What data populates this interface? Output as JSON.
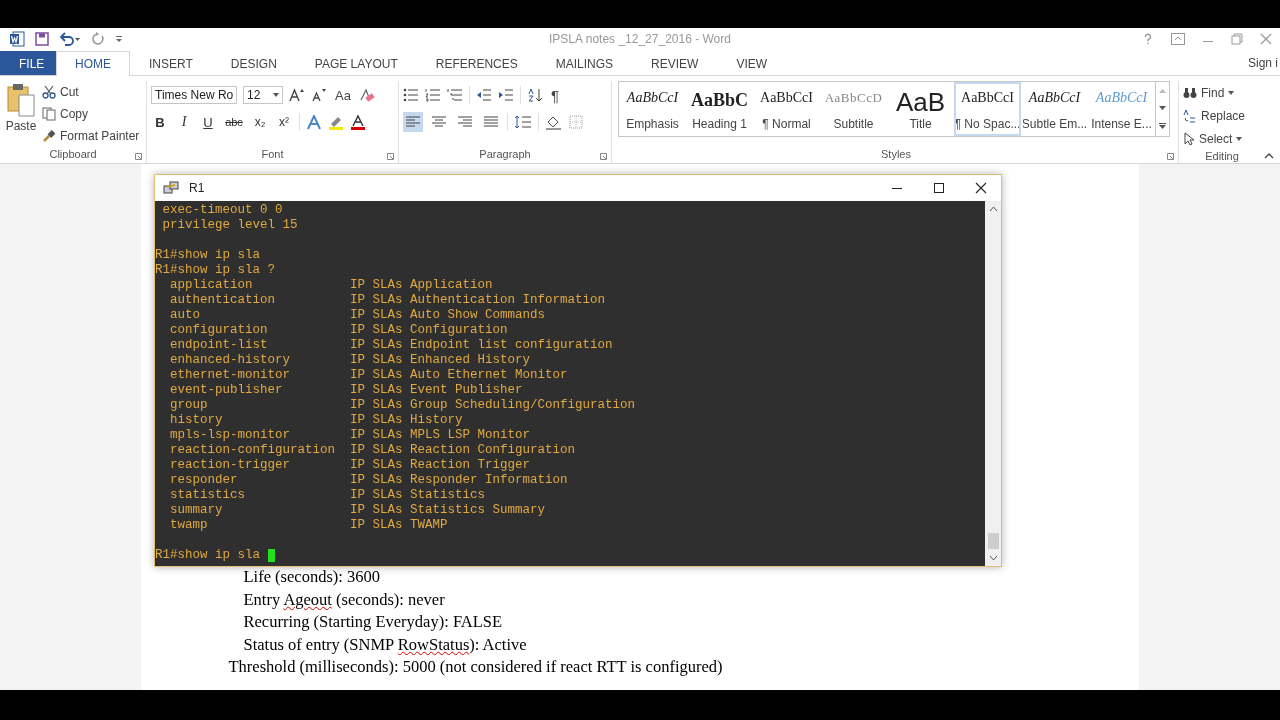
{
  "window": {
    "title": "IPSLA notes _12_27_2016 - Word",
    "sign_in": "Sign i"
  },
  "tabs": [
    {
      "label": "FILE",
      "kind": "file",
      "selected": false
    },
    {
      "label": "HOME",
      "kind": "tab",
      "selected": true
    },
    {
      "label": "INSERT",
      "kind": "tab",
      "selected": false
    },
    {
      "label": "DESIGN",
      "kind": "tab",
      "selected": false
    },
    {
      "label": "PAGE LAYOUT",
      "kind": "tab",
      "selected": false
    },
    {
      "label": "REFERENCES",
      "kind": "tab",
      "selected": false
    },
    {
      "label": "MAILINGS",
      "kind": "tab",
      "selected": false
    },
    {
      "label": "REVIEW",
      "kind": "tab",
      "selected": false
    },
    {
      "label": "VIEW",
      "kind": "tab",
      "selected": false
    }
  ],
  "clipboard": {
    "label": "Clipboard",
    "paste": "Paste",
    "items": [
      {
        "kind": "cut",
        "label": "Cut"
      },
      {
        "kind": "copy",
        "label": "Copy"
      },
      {
        "kind": "painter",
        "label": "Format Painter"
      }
    ]
  },
  "font": {
    "label": "Font",
    "name": "Times New Ro",
    "size": "12",
    "case_button": "Aa",
    "format_buttons": [
      {
        "kind": "bold",
        "label": "B"
      },
      {
        "kind": "italic",
        "label": "I"
      },
      {
        "kind": "underline",
        "label": "U"
      },
      {
        "kind": "strike",
        "label": "abc"
      },
      {
        "kind": "sub",
        "label": "x₂"
      },
      {
        "kind": "sup",
        "label": "x²"
      }
    ]
  },
  "paragraph": {
    "label": "Paragraph",
    "marks": "¶",
    "alignments": [
      {
        "kind": "left",
        "selected": true
      },
      {
        "kind": "center",
        "selected": false
      },
      {
        "kind": "right",
        "selected": false
      },
      {
        "kind": "justify",
        "selected": false
      }
    ]
  },
  "styles": {
    "label": "Styles",
    "items": [
      {
        "kind": "emphasis",
        "preview": "AaBbCcI",
        "label": "Emphasis",
        "selected": false
      },
      {
        "kind": "heading",
        "preview": "AaBbC",
        "label": "Heading 1",
        "selected": false
      },
      {
        "kind": "normal",
        "preview": "AaBbCcI",
        "label": "¶ Normal",
        "selected": false
      },
      {
        "kind": "subtitle",
        "preview": "AaBbCcD",
        "label": "Subtitle",
        "selected": false
      },
      {
        "kind": "title",
        "preview": "AaB",
        "label": "Title",
        "selected": false
      },
      {
        "kind": "normal",
        "preview": "AaBbCcI",
        "label": "¶ No Spac...",
        "selected": true
      },
      {
        "kind": "emphasis",
        "preview": "AaBbCcI",
        "label": "Subtle Em...",
        "selected": false
      },
      {
        "kind": "intense",
        "preview": "AaBbCcI",
        "label": "Intense E...",
        "selected": false
      }
    ]
  },
  "editing": {
    "label": "Editing",
    "items": [
      {
        "kind": "find",
        "label": "Find"
      },
      {
        "kind": "replace",
        "label": "Replace"
      },
      {
        "kind": "select",
        "label": "Select"
      }
    ]
  },
  "terminal": {
    "title": "R1",
    "lines": [
      {
        "kind": "config",
        "text": "exec-timeout 0 0"
      },
      {
        "kind": "config",
        "text": "privilege level 15"
      },
      {
        "kind": "blank"
      },
      {
        "kind": "prompt",
        "text": "R1#show ip sla"
      },
      {
        "kind": "prompt",
        "text": "R1#show ip sla ?"
      },
      {
        "kind": "option",
        "command": "application",
        "description": "IP SLAs Application"
      },
      {
        "kind": "option",
        "command": "authentication",
        "description": "IP SLAs Authentication Information"
      },
      {
        "kind": "option",
        "command": "auto",
        "description": "IP SLAs Auto Show Commands"
      },
      {
        "kind": "option",
        "command": "configuration",
        "description": "IP SLAs Configuration"
      },
      {
        "kind": "option",
        "command": "endpoint-list",
        "description": "IP SLAs Endpoint list configuration"
      },
      {
        "kind": "option",
        "command": "enhanced-history",
        "description": "IP SLAs Enhanced History"
      },
      {
        "kind": "option",
        "command": "ethernet-monitor",
        "description": "IP SLAs Auto Ethernet Monitor"
      },
      {
        "kind": "option",
        "command": "event-publisher",
        "description": "IP SLAs Event Publisher"
      },
      {
        "kind": "option",
        "command": "group",
        "description": "IP SLAs Group Scheduling/Configuration"
      },
      {
        "kind": "option",
        "command": "history",
        "description": "IP SLAs History"
      },
      {
        "kind": "option",
        "command": "mpls-lsp-monitor",
        "description": "IP SLAs MPLS LSP Monitor"
      },
      {
        "kind": "option",
        "command": "reaction-configuration",
        "description": "IP SLAs Reaction Configuration"
      },
      {
        "kind": "option",
        "command": "reaction-trigger",
        "description": "IP SLAs Reaction Trigger"
      },
      {
        "kind": "option",
        "command": "responder",
        "description": "IP SLAs Responder Information"
      },
      {
        "kind": "option",
        "command": "statistics",
        "description": "IP SLAs Statistics"
      },
      {
        "kind": "option",
        "command": "summary",
        "description": "IP SLAs Statistics Summary"
      },
      {
        "kind": "option",
        "command": "twamp",
        "description": "IP SLAs TWAMP"
      },
      {
        "kind": "blank"
      },
      {
        "kind": "input",
        "text": "R1#show ip sla"
      }
    ]
  },
  "document": {
    "lines": [
      {
        "kind": "nested",
        "segments": [
          {
            "text": "Life (seconds): 3600",
            "misspelled": false
          }
        ]
      },
      {
        "kind": "nested",
        "segments": [
          {
            "text": "Entry ",
            "misspelled": false
          },
          {
            "text": "Ageout",
            "misspelled": true
          },
          {
            "text": " (seconds): never",
            "misspelled": false
          }
        ]
      },
      {
        "kind": "nested",
        "segments": [
          {
            "text": "Recurring (Starting Everyday): FALSE",
            "misspelled": false
          }
        ]
      },
      {
        "kind": "nested",
        "segments": [
          {
            "text": "Status of entry (SNMP ",
            "misspelled": false
          },
          {
            "text": "RowStatus",
            "misspelled": true
          },
          {
            "text": "): Active",
            "misspelled": false
          }
        ]
      },
      {
        "kind": "plain",
        "segments": [
          {
            "text": "Threshold (milliseconds): 5000 (not considered if react RTT is configured)",
            "misspelled": false
          }
        ]
      }
    ]
  }
}
